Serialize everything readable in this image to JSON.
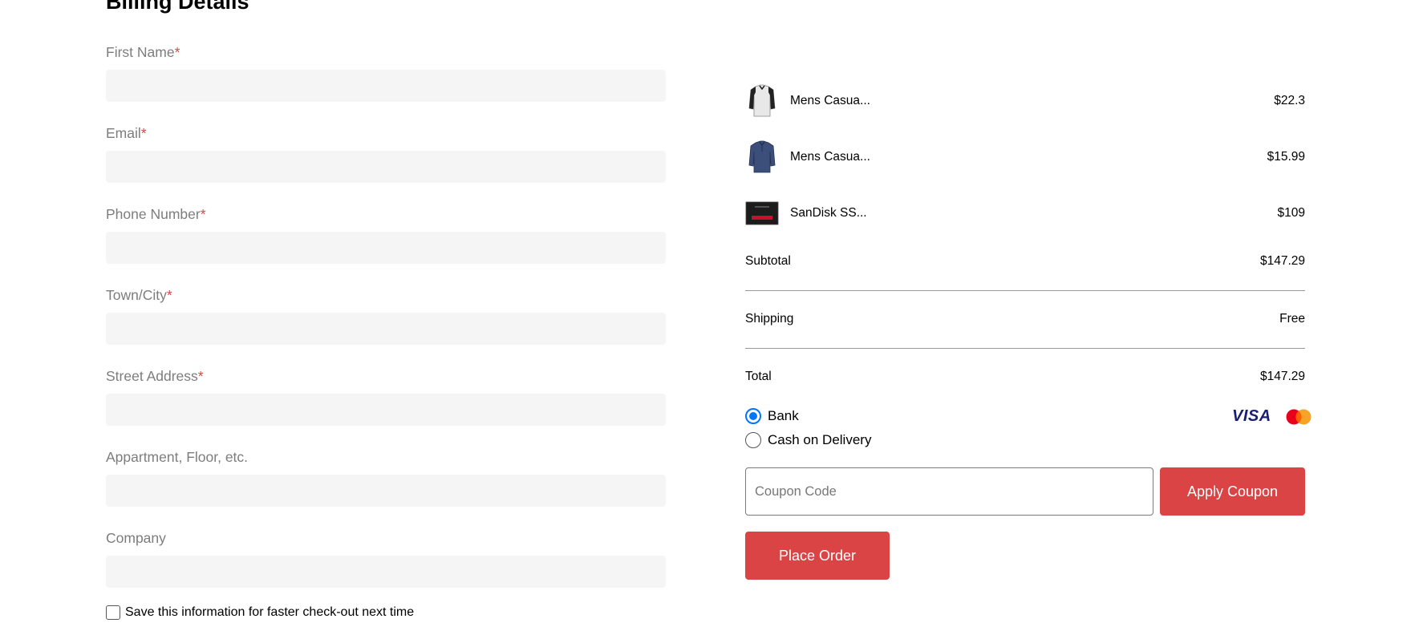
{
  "page": {
    "title": "Billing Details"
  },
  "form": {
    "fields": [
      {
        "label": "First Name",
        "required": "*"
      },
      {
        "label": "Email",
        "required": "*"
      },
      {
        "label": "Phone Number",
        "required": "*"
      },
      {
        "label": "Town/City",
        "required": "*"
      },
      {
        "label": "Street Address",
        "required": "*"
      },
      {
        "label": "Appartment, Floor, etc.",
        "required": ""
      },
      {
        "label": "Company",
        "required": ""
      }
    ],
    "save_label": "Save this information for faster check-out next time"
  },
  "summary": {
    "items": [
      {
        "name": "Mens Casua...",
        "price": "$22.3",
        "icon": "shirt-icon"
      },
      {
        "name": "Mens Casua...",
        "price": "$15.99",
        "icon": "shirt-icon"
      },
      {
        "name": "SanDisk SS...",
        "price": "$109",
        "icon": "ssd-icon"
      }
    ],
    "subtotal_label": "Subtotal",
    "subtotal_value": "$147.29",
    "shipping_label": "Shipping",
    "shipping_value": "Free",
    "total_label": "Total",
    "total_value": "$147.29",
    "payment": {
      "bank_label": "Bank",
      "cod_label": "Cash on Delivery",
      "selected": "Bank",
      "cards": [
        "VISA",
        "mastercard-icon"
      ]
    },
    "coupon_placeholder": "Coupon Code",
    "apply_label": "Apply Coupon",
    "place_order_label": "Place Order"
  },
  "colors": {
    "accent": "#db4444",
    "input_bg": "#f5f5f5",
    "label_gray": "#7d7d7d",
    "radio_blue": "#0075ff"
  }
}
